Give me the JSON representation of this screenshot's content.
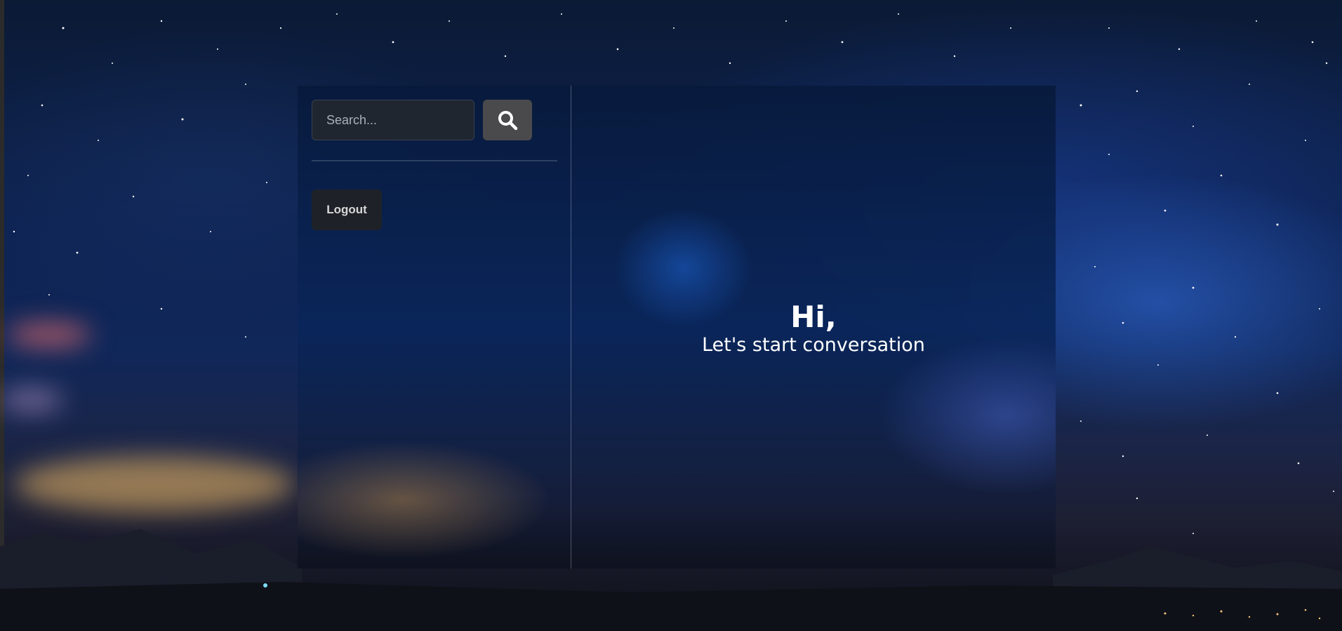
{
  "sidebar": {
    "search": {
      "placeholder": "Search...",
      "value": ""
    },
    "search_button_icon": "search-icon",
    "logout_label": "Logout"
  },
  "chat": {
    "greeting_title": "Hi,",
    "greeting_subtitle": "Let's start conversation"
  },
  "colors": {
    "search_button_bg": "#4a4a4c",
    "logout_button_bg": "#1e2228",
    "input_bg": "#1f2630",
    "text_primary": "#ffffff"
  }
}
